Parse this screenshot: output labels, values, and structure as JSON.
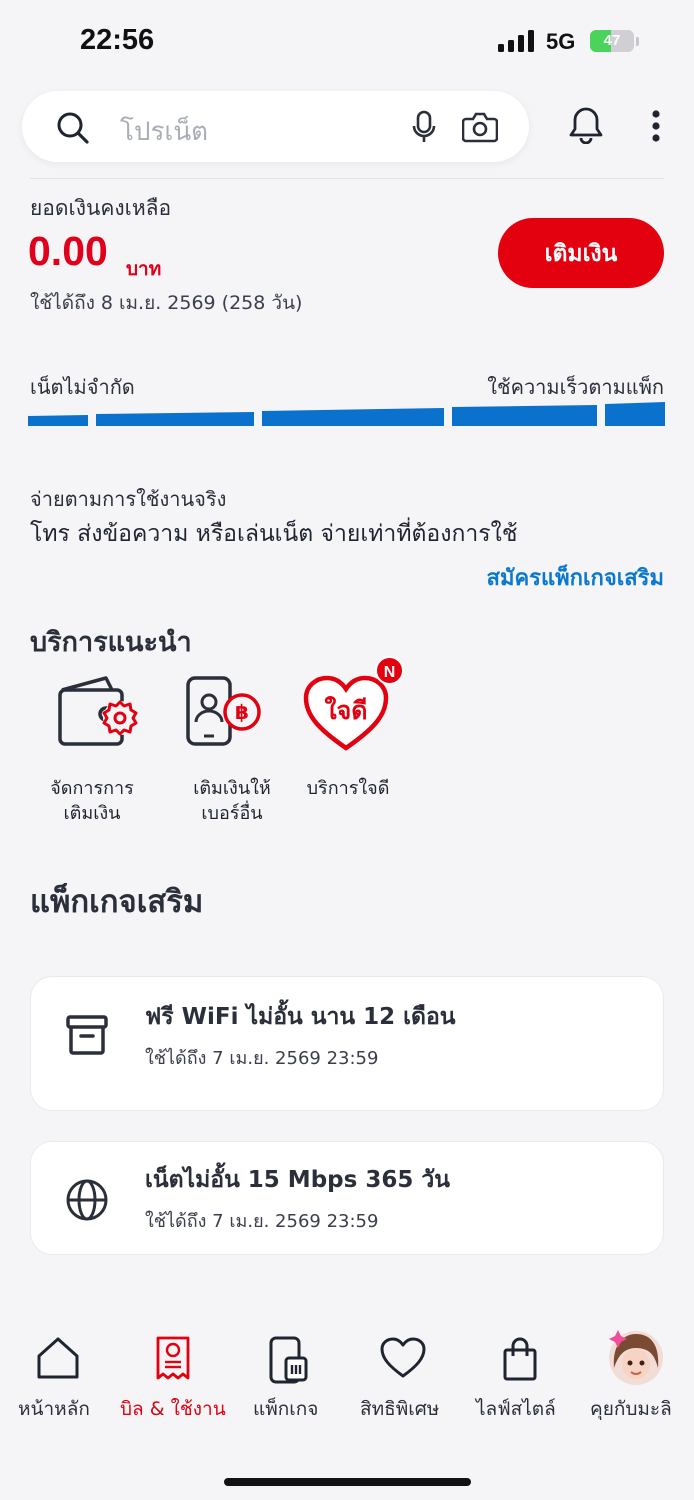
{
  "status_bar": {
    "time": "22:56",
    "network": "5G",
    "battery": "47",
    "battery_level": 0.47
  },
  "search": {
    "placeholder": "โปรเน็ต"
  },
  "balance": {
    "label": "ยอดเงินคงเหลือ",
    "amount": "0.00",
    "unit": "บาท",
    "valid_until": "ใช้ได้ถึง 8 เม.ย. 2569 (258 วัน)",
    "topup_label": "เติมเงิน"
  },
  "speed": {
    "left_label": "เน็ตไม่จำกัด",
    "right_label": "ใช้ความเร็วตามแพ็ก"
  },
  "payg": {
    "label": "จ่ายตามการใช้งานจริง",
    "description": "โทร ส่งข้อความ หรือเล่นเน็ต จ่ายเท่าที่ต้องการใช้",
    "link": "สมัครแพ็กเกจเสริม"
  },
  "recommended": {
    "title": "บริการแนะนำ",
    "items": [
      {
        "line1": "จัดการการ",
        "line2": "เติมเงิน",
        "icon": "wallet-gear-icon"
      },
      {
        "line1": "เติมเงินให้",
        "line2": "เบอร์อื่น",
        "icon": "phone-baht-icon"
      },
      {
        "line1": "บริการใจดี",
        "line2": "",
        "icon": "jaidee-heart-icon",
        "badge": "N",
        "logo_text": "ใจดี"
      }
    ]
  },
  "packs": {
    "title": "แพ็กเกจเสริม",
    "items": [
      {
        "name": "ฟรี WiFi ไม่อั้น นาน 12 เดือน",
        "valid": "ใช้ได้ถึง 7 เม.ย. 2569 23:59",
        "icon": "archive-box-icon"
      },
      {
        "name": "เน็ตไม่อั้น 15 Mbps 365 วัน",
        "valid": "ใช้ได้ถึง 7 เม.ย. 2569 23:59",
        "icon": "globe-icon"
      }
    ]
  },
  "bottom_nav": {
    "items": [
      {
        "label": "หน้าหลัก",
        "icon": "home-icon",
        "active": false
      },
      {
        "label": "บิล & ใช้งาน",
        "icon": "bill-icon",
        "active": true
      },
      {
        "label": "แพ็กเกจ",
        "icon": "phone-sim-icon",
        "active": false
      },
      {
        "label": "สิทธิพิเศษ",
        "icon": "heart-icon",
        "active": false
      },
      {
        "label": "ไลฟ์สไตล์",
        "icon": "shopping-bag-icon",
        "active": false
      },
      {
        "label": "คุยกับมะลิ",
        "icon": "chatbot-avatar-icon",
        "active": false
      }
    ]
  },
  "colors": {
    "accent_red": "#e3000f",
    "link_blue": "#0a78cc",
    "bar_blue": "#0a72cc"
  }
}
